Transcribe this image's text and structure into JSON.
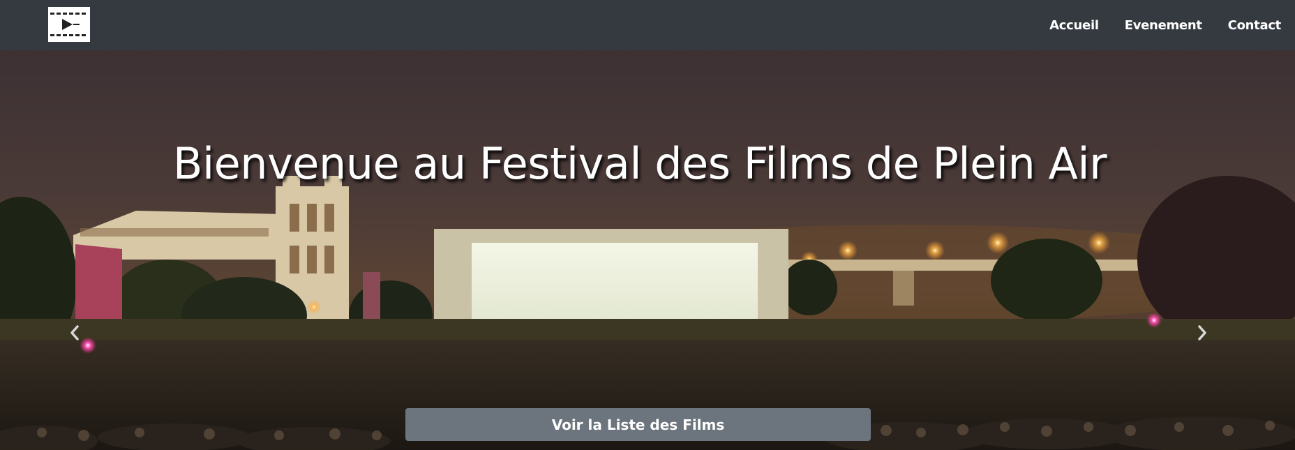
{
  "navbar": {
    "logo_icon": "film-strip-play-icon",
    "links": [
      "Accueil",
      "Evenement",
      "Contact"
    ]
  },
  "hero": {
    "title": "Bienvenue au Festival des Films de Plein Air",
    "button_label": "Voir la Liste des Films",
    "prev_icon": "chevron-left-icon",
    "next_icon": "chevron-right-icon"
  },
  "colors": {
    "navbar_bg": "#343a40",
    "button_bg": "#6c757d",
    "text": "#ffffff"
  }
}
